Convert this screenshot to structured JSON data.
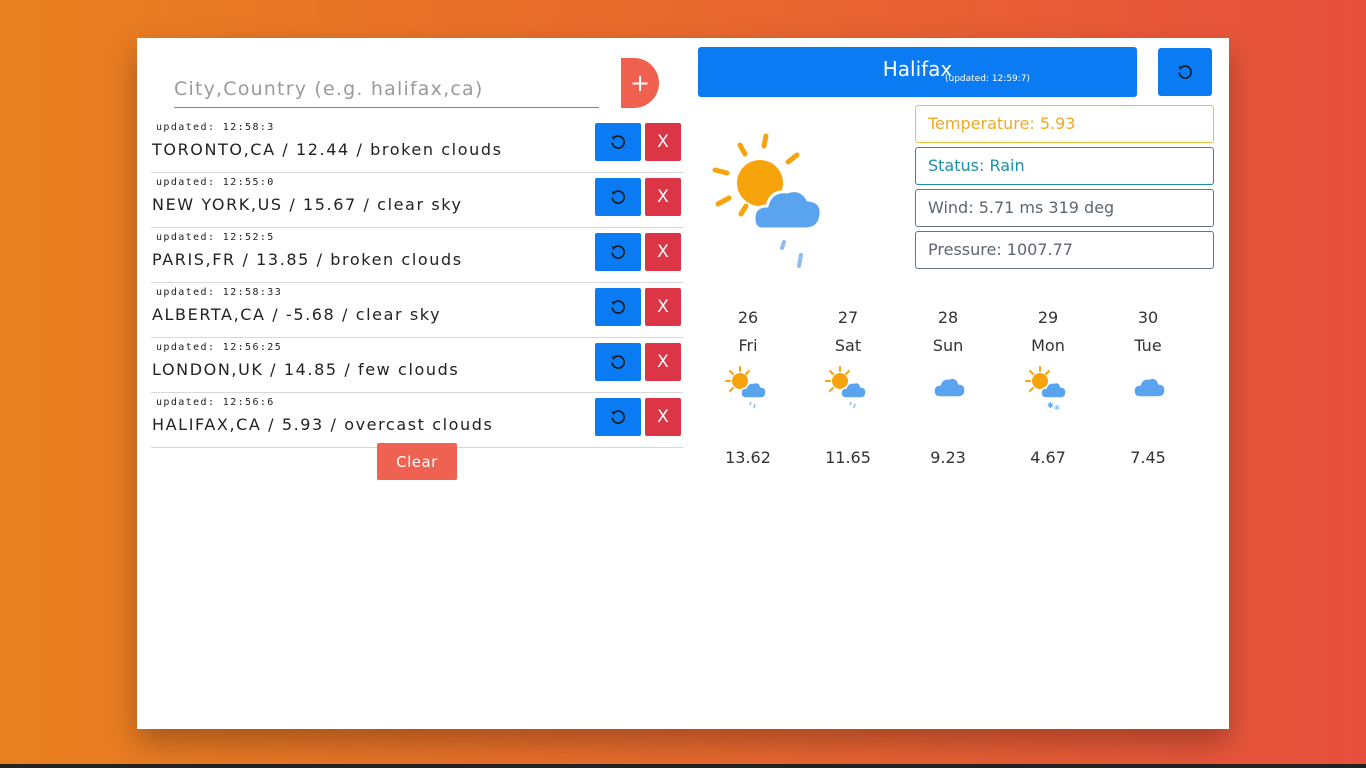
{
  "search": {
    "placeholder": "City,Country (e.g. halifax,ca)",
    "add_label": "+"
  },
  "cities": [
    {
      "updated": "updated: 12:58:3",
      "summary": "TORONTO,CA / 12.44 / broken clouds",
      "delete_label": "X"
    },
    {
      "updated": "updated: 12:55:0",
      "summary": "NEW YORK,US / 15.67 / clear sky",
      "delete_label": "X"
    },
    {
      "updated": "updated: 12:52:5",
      "summary": "PARIS,FR / 13.85 / broken clouds",
      "delete_label": "X"
    },
    {
      "updated": "updated: 12:58:33",
      "summary": "ALBERTA,CA / -5.68 / clear sky",
      "delete_label": "X"
    },
    {
      "updated": "updated: 12:56:25",
      "summary": "LONDON,UK / 14.85 / few clouds",
      "delete_label": "X"
    },
    {
      "updated": "updated: 12:56:6",
      "summary": "HALIFAX,CA / 5.93 / overcast clouds",
      "delete_label": "X"
    }
  ],
  "clear_label": "Clear",
  "current": {
    "city": "Halifax",
    "updated": "(updated: 12:59:7)",
    "temperature": "Temperature: 5.93",
    "status": "Status: Rain",
    "wind": "Wind: 5.71 ms 319 deg",
    "pressure": "Pressure: 1007.77",
    "icon": "sun-cloud-rain-icon"
  },
  "forecast": [
    {
      "date": "26",
      "day": "Fri",
      "temp": "13.62",
      "icon": "sun-cloud-rain-icon"
    },
    {
      "date": "27",
      "day": "Sat",
      "temp": "11.65",
      "icon": "sun-cloud-rain-icon"
    },
    {
      "date": "28",
      "day": "Sun",
      "temp": "9.23",
      "icon": "cloud-icon"
    },
    {
      "date": "29",
      "day": "Mon",
      "temp": "4.67",
      "icon": "sun-cloud-snow-icon"
    },
    {
      "date": "30",
      "day": "Tue",
      "temp": "7.45",
      "icon": "cloud-icon"
    }
  ],
  "colors": {
    "primary": "#0a7bf2",
    "danger": "#dc3545",
    "accent": "#f0604f",
    "warning": "#f2a922",
    "info": "#1d8fa8",
    "secondary": "#6c757d"
  }
}
